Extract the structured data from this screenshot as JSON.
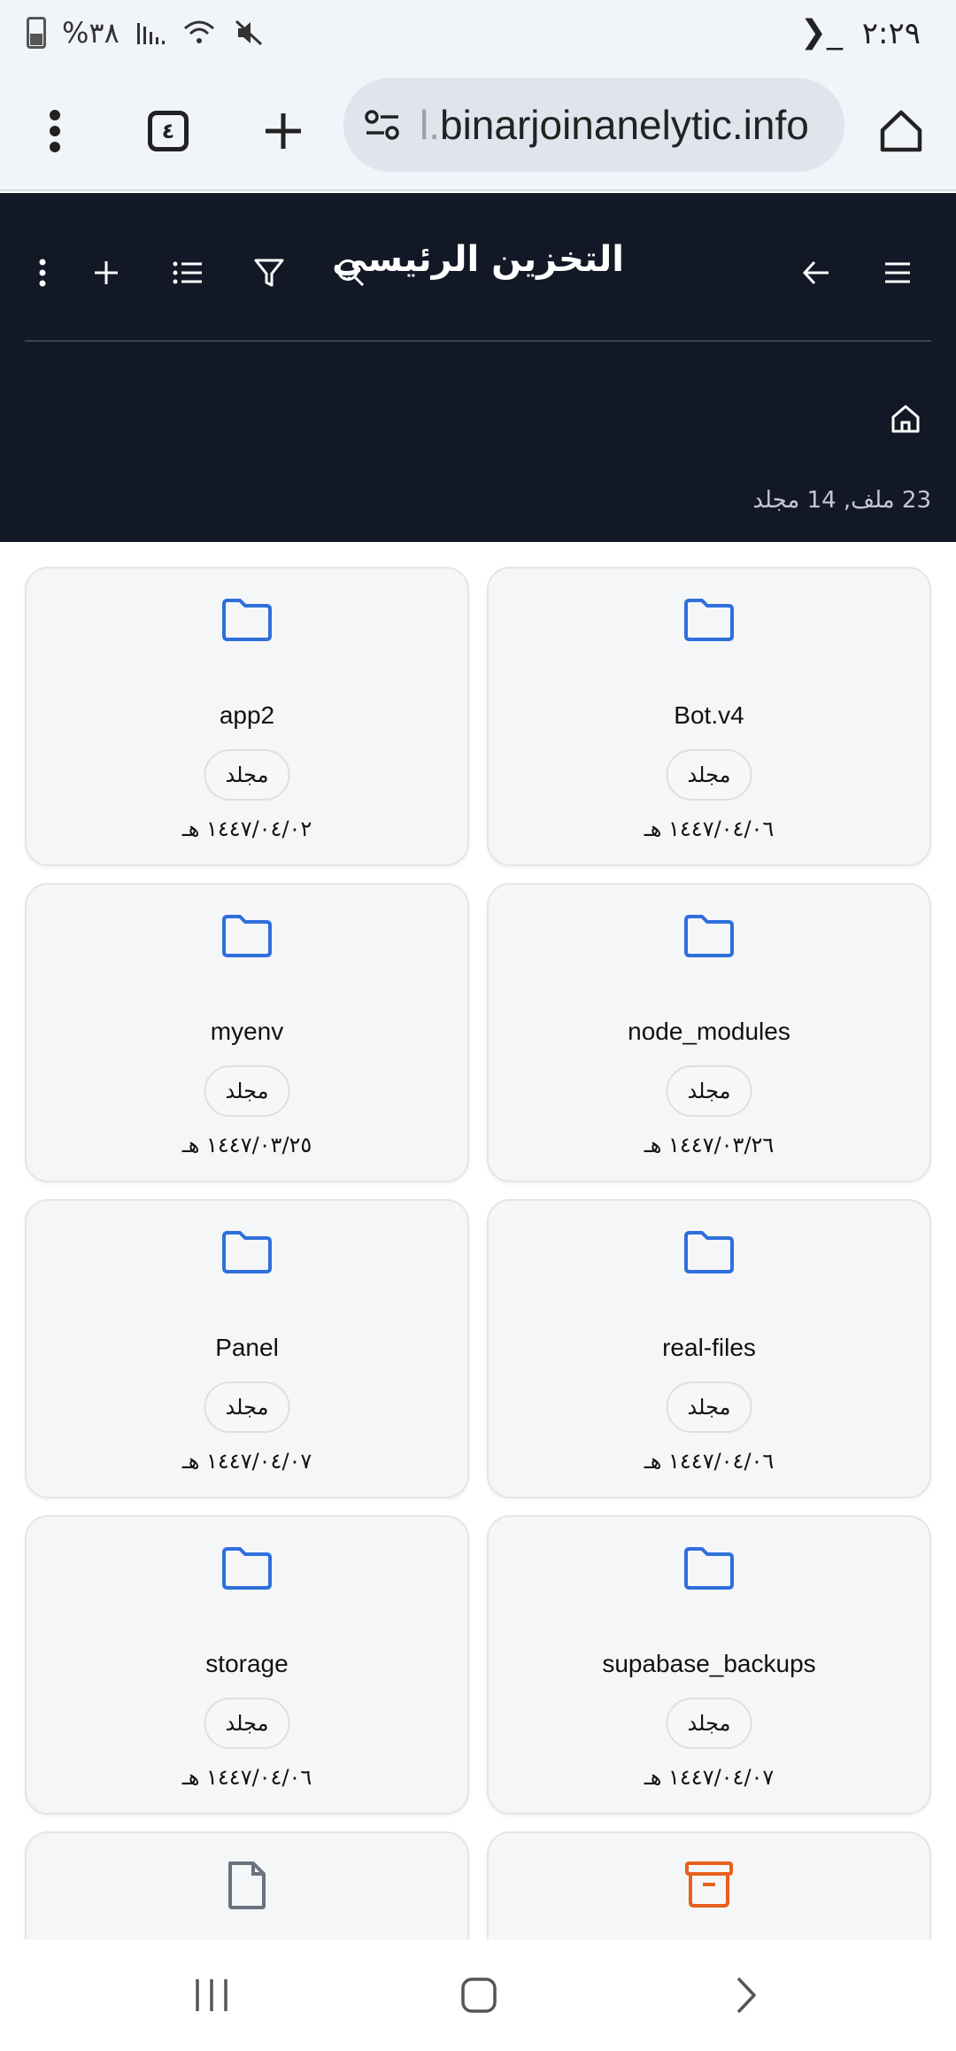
{
  "status_bar": {
    "time": "٢:٢٩",
    "terminal_glyph": "❯_",
    "battery_text": "%٣٨"
  },
  "browser": {
    "url_prefix": "l.",
    "url_main": "binarjoinanelytic.info",
    "tab_count": "٤"
  },
  "header": {
    "title": "التخزين الرئيسي",
    "summary": "23 ملف, 14 مجلد"
  },
  "items": [
    {
      "name": "Bot.v4",
      "type": "مجلد",
      "date": "١٤٤٧/٠٤/٠٦ هـ",
      "icon": "folder-icon"
    },
    {
      "name": "app2",
      "type": "مجلد",
      "date": "١٤٤٧/٠٤/٠٢ هـ",
      "icon": "folder-icon"
    },
    {
      "name": "node_modules",
      "type": "مجلد",
      "date": "١٤٤٧/٠٣/٢٦ هـ",
      "icon": "folder-icon"
    },
    {
      "name": "myenv",
      "type": "مجلد",
      "date": "١٤٤٧/٠٣/٢٥ هـ",
      "icon": "folder-icon"
    },
    {
      "name": "real-files",
      "type": "مجلد",
      "date": "١٤٤٧/٠٤/٠٦ هـ",
      "icon": "folder-icon"
    },
    {
      "name": "Panel",
      "type": "مجلد",
      "date": "١٤٤٧/٠٤/٠٧ هـ",
      "icon": "folder-icon"
    },
    {
      "name": "supabase_backups",
      "type": "مجلد",
      "date": "١٤٤٧/٠٤/٠٧ هـ",
      "icon": "folder-icon"
    },
    {
      "name": "storage",
      "type": "مجلد",
      "date": "١٤٤٧/٠٤/٠٦ هـ",
      "icon": "folder-icon"
    }
  ],
  "partial_items": [
    {
      "icon": "archive-icon",
      "color": "#e8601c"
    },
    {
      "icon": "file-icon",
      "color": "#6b7280"
    }
  ],
  "colors": {
    "header_bg": "#121826",
    "folder_blue": "#2f6fdc",
    "archive_orange": "#e8601c"
  }
}
